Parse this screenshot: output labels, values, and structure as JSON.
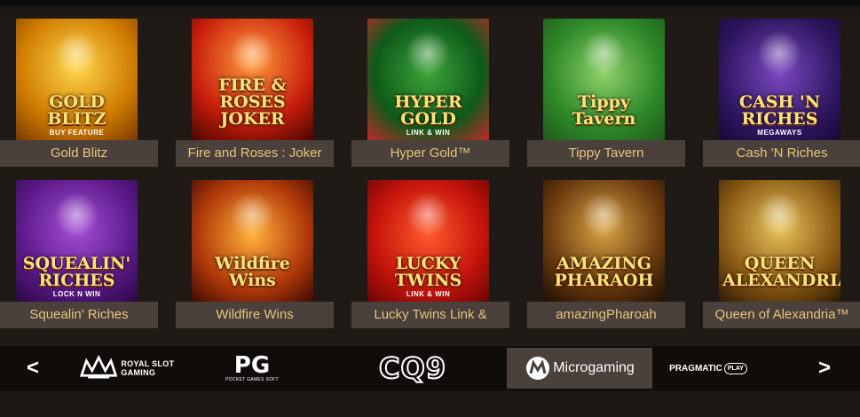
{
  "colors": {
    "label_bg": "#4a403c",
    "label_text": "#e8c57a",
    "background": "#1f1a15",
    "provider_bar": "#0f0c09"
  },
  "games": [
    {
      "title": "Gold Blitz",
      "logo": "GOLD BLITZ",
      "sub": "BUY FEATURE",
      "bg": "radial-gradient(circle at 50% 40%,#ffd64a,#d07c00 60%,#7a3a00)",
      "icon": "lightning-bolt-icon"
    },
    {
      "title": "Fire and Roses : Joker",
      "logo": "FIRE & ROSES JOKER",
      "sub": "",
      "bg": "radial-gradient(circle at 50% 35%,#ff9a3a,#c81e0c 60%,#4a0600)",
      "icon": "jester-icon"
    },
    {
      "title": "Hyper Gold™",
      "logo": "HYPER GOLD",
      "sub": "LINK & WIN",
      "bg": "radial-gradient(circle at 50% 45%,#3da43a,#0e5a1a 60%,#c0282a)",
      "icon": "dollar-signs-icon"
    },
    {
      "title": "Tippy Tavern",
      "logo": "Tippy Tavern",
      "sub": "",
      "bg": "radial-gradient(circle at 50% 45%,#8fd06a,#2f8a2a 60%,#1f5a1a)",
      "icon": "leprechaun-icon"
    },
    {
      "title": "Cash 'N Riches",
      "logo": "CASH 'N RICHES",
      "sub": "MEGAWAYS",
      "bg": "radial-gradient(circle at 50% 45%,#7a48c0,#2e1660 65%,#170a36)",
      "icon": "money-icon"
    },
    {
      "title": "Squealin' Riches",
      "logo": "SQUEALIN' RICHES",
      "sub": "LOCK N WIN",
      "bg": "radial-gradient(circle at 50% 40%,#a44fd6,#5c1a8a 60%,#2c0846)",
      "icon": "pig-icon"
    },
    {
      "title": "Wildfire Wins",
      "logo": "Wildfire Wins",
      "sub": "",
      "bg": "radial-gradient(circle at 50% 45%,#ffb13a,#b23a0a 60%,#3e0a04)",
      "icon": "wheel-icon"
    },
    {
      "title": "Lucky Twins Link &",
      "logo": "LUCKY TWINS",
      "sub": "LINK & WIN",
      "bg": "radial-gradient(circle at 50% 45%,#ff5a2a,#c4140c 60%,#6a0404)",
      "icon": "twins-icon"
    },
    {
      "title": "amazingPharoah",
      "logo": "AMAZING PHARAOH",
      "sub": "",
      "bg": "radial-gradient(circle at 50% 40%,#d9a445,#6a3a0e 60%,#1e0f04)",
      "icon": "pharaoh-icon"
    },
    {
      "title": "Queen of Alexandria™",
      "logo": "QUEEN ALEXANDRIA",
      "sub": "",
      "bg": "radial-gradient(circle at 50% 40%,#e8c25a,#8a5a14 60%,#2e1a04)",
      "icon": "queen-icon"
    }
  ],
  "providers": {
    "prev_arrow": "<",
    "next_arrow": ">",
    "royal": "ROYAL SLOT GAMING",
    "pg": "PG",
    "pg_sub": "POCKET GAMES SOFT",
    "cq9": "CQ9",
    "microgaming": "Microgaming",
    "pragmatic": "PRAGMATIC",
    "pragmatic_play": "PLAY"
  }
}
